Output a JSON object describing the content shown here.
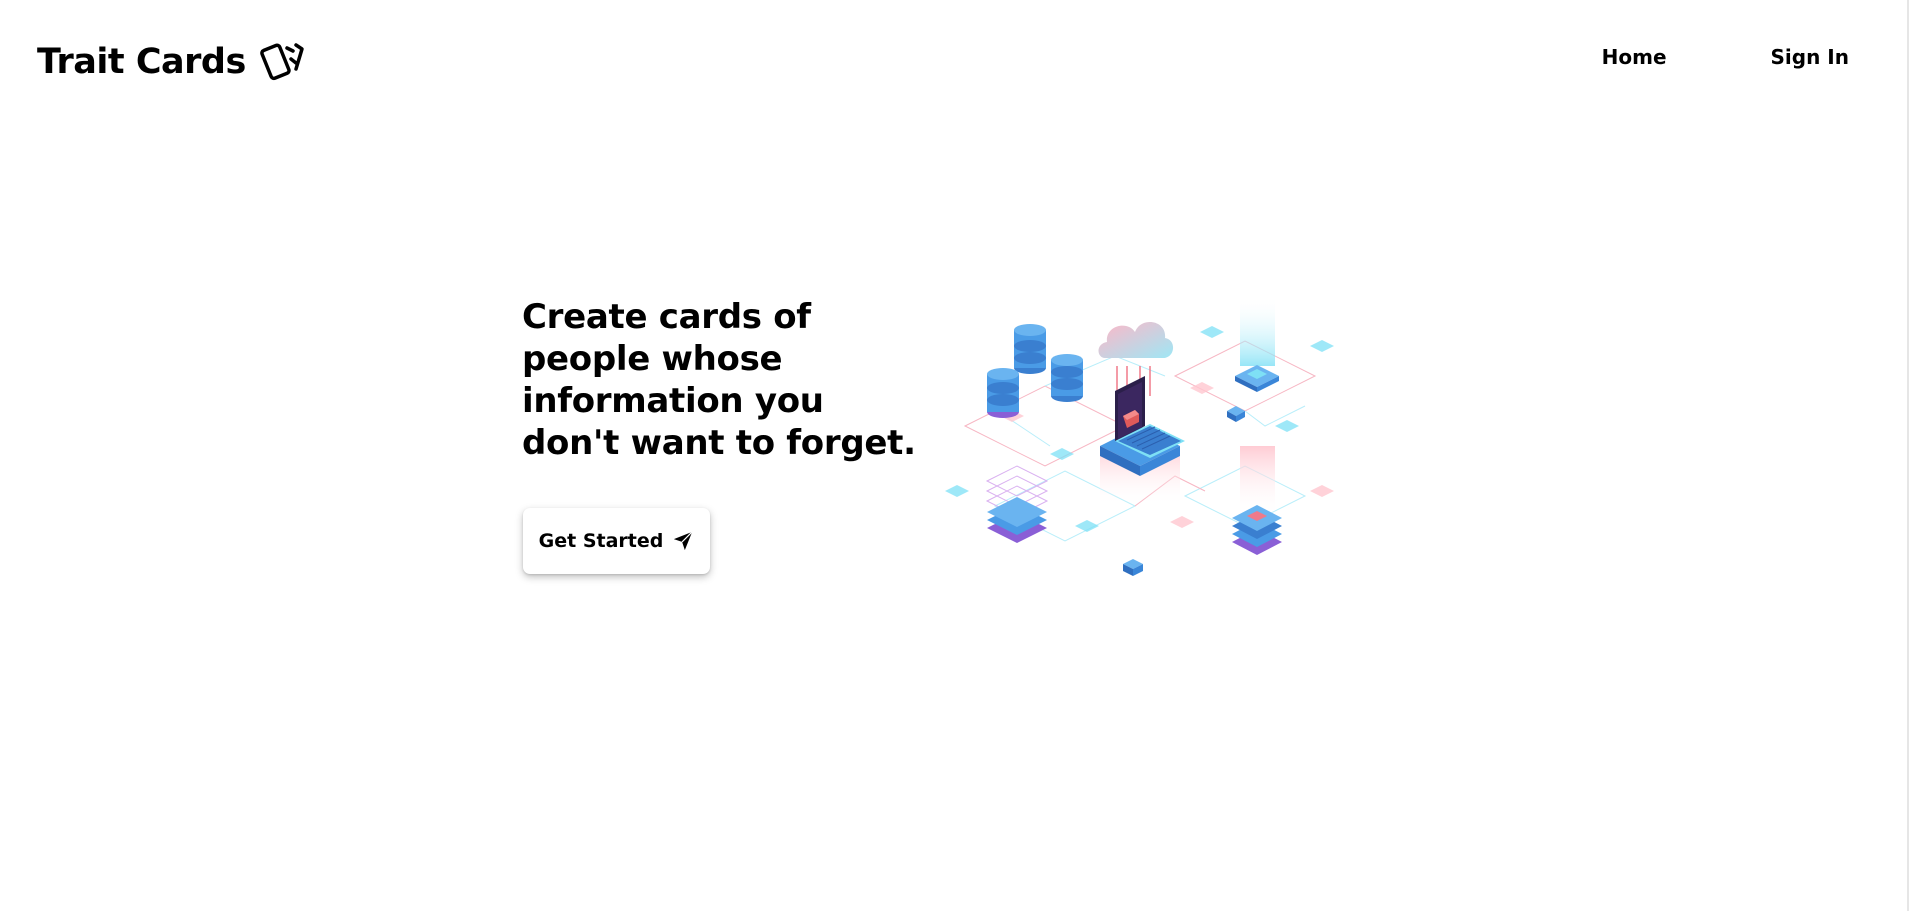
{
  "brand": {
    "name": "Trait Cards",
    "icon": "cards-icon"
  },
  "nav": {
    "home": "Home",
    "sign_in": "Sign In"
  },
  "hero": {
    "headline": "Create cards of people whose information you don't want to forget.",
    "cta_label": "Get Started",
    "cta_icon": "paper-plane-icon"
  },
  "illustration": {
    "subject": "isometric cloud network illustration",
    "colors": {
      "blue": "#4a9be6",
      "purple": "#8a5fd6",
      "pink": "#f07a8a",
      "cyan": "#7ee0f5",
      "dark": "#2b1f4a"
    }
  }
}
